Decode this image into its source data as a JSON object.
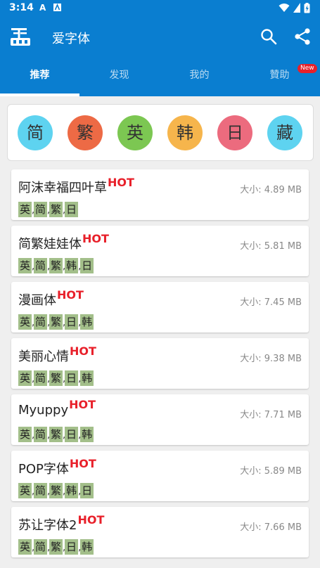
{
  "status_bar": {
    "time": "3:14"
  },
  "app_bar": {
    "title": "爱字体"
  },
  "tabs": [
    {
      "label": "推荐",
      "active": true
    },
    {
      "label": "发现",
      "active": false
    },
    {
      "label": "我的",
      "active": false
    },
    {
      "label": "贊助",
      "active": false,
      "badge": "New"
    }
  ],
  "languages": [
    {
      "label": "简",
      "color": "#5ed3f0"
    },
    {
      "label": "繁",
      "color": "#ed6a45"
    },
    {
      "label": "英",
      "color": "#7cc752"
    },
    {
      "label": "韩",
      "color": "#f6b54c"
    },
    {
      "label": "日",
      "color": "#ec6b7e"
    },
    {
      "label": "藏",
      "color": "#5ed3f0"
    }
  ],
  "fonts": [
    {
      "name": "阿沫幸福四叶草",
      "hot": "HOT",
      "size": "大小: 4.89 MB",
      "tags": [
        "英",
        "简",
        "繁",
        "日"
      ]
    },
    {
      "name": "简繁娃娃体",
      "hot": "HOT",
      "size": "大小: 5.81 MB",
      "tags": [
        "英",
        "简",
        "繁",
        "韩",
        "日"
      ]
    },
    {
      "name": "漫画体",
      "hot": "HOT",
      "size": "大小: 7.45 MB",
      "tags": [
        "英",
        "简",
        "繁",
        "日",
        "韩"
      ]
    },
    {
      "name": "美丽心情",
      "hot": "HOT",
      "size": "大小: 9.38 MB",
      "tags": [
        "英",
        "简",
        "繁",
        "日",
        "韩"
      ]
    },
    {
      "name": "Myuppy",
      "hot": "HOT",
      "size": "大小: 7.71 MB",
      "tags": [
        "英",
        "简",
        "繁",
        "日",
        "韩"
      ]
    },
    {
      "name": "POP字体",
      "hot": "HOT",
      "size": "大小: 5.89 MB",
      "tags": [
        "英",
        "简",
        "繁",
        "韩",
        "日"
      ]
    },
    {
      "name": "苏让字体2",
      "hot": "HOT",
      "size": "大小: 7.66 MB",
      "tags": [
        "英",
        "简",
        "繁",
        "日",
        "韩"
      ]
    }
  ],
  "tag_separator": ",",
  "theme": {
    "primary": "#0a7ed0",
    "hot": "#e8202a",
    "tag_bg": "#a3bf8a"
  }
}
